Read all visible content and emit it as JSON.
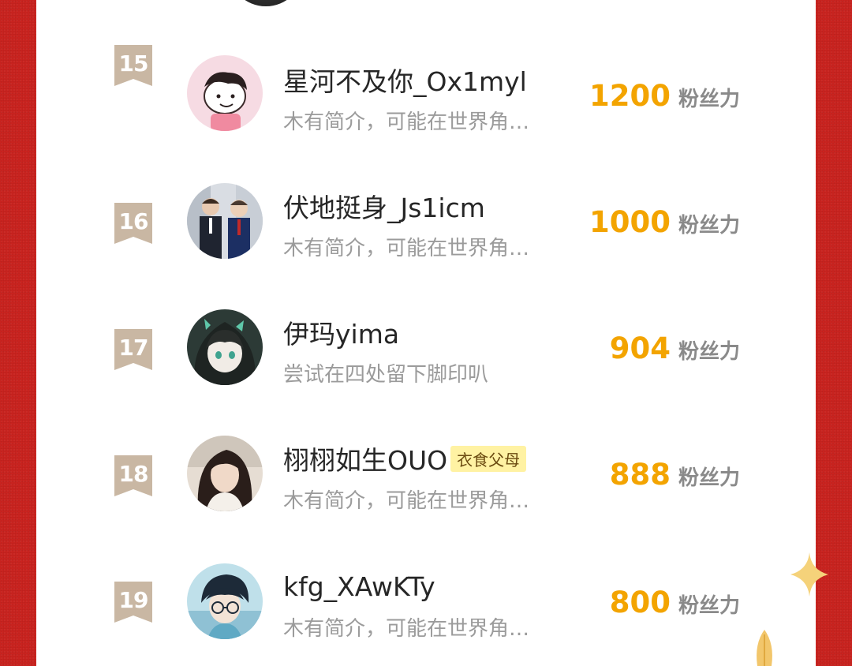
{
  "leaderboard": {
    "unit": "粉丝力",
    "entries": [
      {
        "rank": "15",
        "name": "星河不及你_Ox1myl",
        "bio": "木有简介，可能在世界角…",
        "score": "1200",
        "tag": "",
        "avatar": "cartoon-girl-avatar"
      },
      {
        "rank": "16",
        "name": "伏地挺身_Js1icm",
        "bio": "木有简介，可能在世界角…",
        "score": "1000",
        "tag": "",
        "avatar": "two-boys-photo-avatar"
      },
      {
        "rank": "17",
        "name": "伊玛yima",
        "bio": "尝试在四处留下脚印叭",
        "score": "904",
        "tag": "",
        "avatar": "anime-girl-avatar"
      },
      {
        "rank": "18",
        "name": "栩栩如生OUO",
        "bio": "木有简介，可能在世界角…",
        "score": "888",
        "tag": "衣食父母",
        "avatar": "girl-photo-avatar"
      },
      {
        "rank": "19",
        "name": "kfg_XAwKTy",
        "bio": "木有简介，可能在世界角…",
        "score": "800",
        "tag": "",
        "avatar": "anime-boy-glasses-avatar"
      }
    ]
  },
  "colors": {
    "background": "#c9231f",
    "score": "#f3a400",
    "rank_badge": "#c9b7a3",
    "tag_bg": "#fff2a3"
  }
}
